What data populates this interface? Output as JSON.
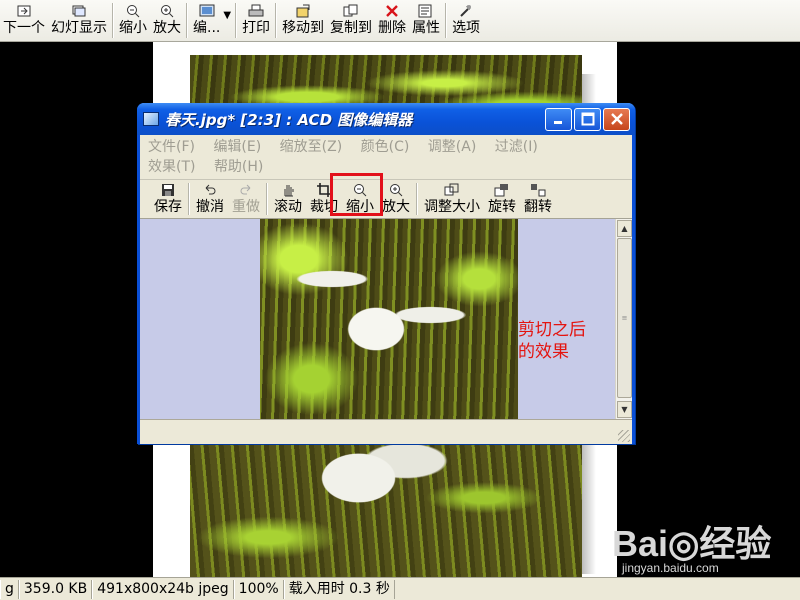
{
  "main_toolbar": {
    "buttons": [
      {
        "label": "下一个",
        "icon": "next-icon"
      },
      {
        "label": "幻灯显示",
        "icon": "slideshow-icon"
      },
      {
        "label": "缩小",
        "icon": "zoom-out-icon"
      },
      {
        "label": "放大",
        "icon": "zoom-in-icon"
      },
      {
        "label": "编...",
        "icon": "edit-icon"
      },
      {
        "label": "打印",
        "icon": "print-icon"
      },
      {
        "label": "移动到",
        "icon": "move-to-icon"
      },
      {
        "label": "复制到",
        "icon": "copy-to-icon"
      },
      {
        "label": "删除",
        "icon": "delete-icon"
      },
      {
        "label": "属性",
        "icon": "properties-icon"
      },
      {
        "label": "选项",
        "icon": "options-icon"
      }
    ]
  },
  "editor": {
    "title": "春天.jpg* [2:3] : ACD 图像编辑器",
    "menu": [
      "文件(F)",
      "编辑(E)",
      "缩放至(Z)",
      "颜色(C)",
      "调整(A)",
      "过滤(I)",
      "效果(T)",
      "帮助(H)"
    ],
    "toolbar": [
      {
        "label": "保存",
        "icon": "save-icon",
        "disabled": false
      },
      {
        "label": "撤消",
        "icon": "undo-icon",
        "disabled": false
      },
      {
        "label": "重做",
        "icon": "redo-icon",
        "disabled": true
      },
      {
        "label": "滚动",
        "icon": "hand-scroll-icon",
        "disabled": false
      },
      {
        "label": "裁切",
        "icon": "crop-icon",
        "disabled": false
      },
      {
        "label": "缩小",
        "icon": "zoom-out-icon",
        "disabled": false
      },
      {
        "label": "放大",
        "icon": "zoom-in-icon",
        "disabled": false
      },
      {
        "label": "调整大小",
        "icon": "resize-icon",
        "disabled": false
      },
      {
        "label": "旋转",
        "icon": "rotate-icon",
        "disabled": false
      },
      {
        "label": "翻转",
        "icon": "flip-icon",
        "disabled": false
      }
    ],
    "annotation": "剪切之后\n的效果",
    "highlight_color": "#e2101a"
  },
  "status_bar": {
    "cells": [
      "g",
      "359.0 KB",
      "491x800x24b jpeg",
      "100%",
      "载入用时 0.3 秒"
    ]
  },
  "watermark": {
    "logo": "Bai◎经验",
    "url": "jingyan.baidu.com"
  }
}
